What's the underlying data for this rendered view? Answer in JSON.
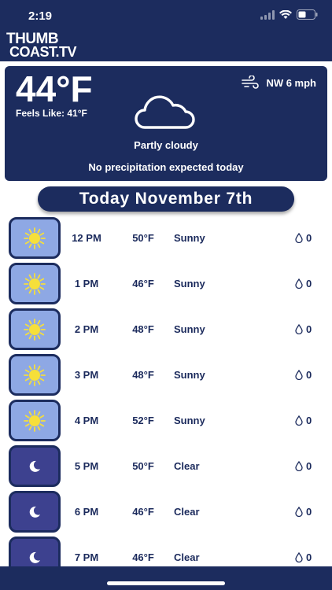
{
  "status": {
    "time": "2:19"
  },
  "logo": {
    "line1": "THUMB",
    "line2": "COAST.TV"
  },
  "current": {
    "temperature": "44°F",
    "feels_like": "Feels Like: 41°F",
    "wind": "NW 6 mph",
    "condition": "Partly cloudy",
    "precipitation": "No precipitation expected today",
    "icon": "cloud-icon"
  },
  "date_heading": "Today November 7th",
  "hourly": [
    {
      "time": "12 PM",
      "temp": "50°F",
      "condition": "Sunny",
      "precip": "0",
      "icon": "sun-icon",
      "period": "day"
    },
    {
      "time": "1 PM",
      "temp": "46°F",
      "condition": "Sunny",
      "precip": "0",
      "icon": "sun-icon",
      "period": "day"
    },
    {
      "time": "2 PM",
      "temp": "48°F",
      "condition": "Sunny",
      "precip": "0",
      "icon": "sun-icon",
      "period": "day"
    },
    {
      "time": "3 PM",
      "temp": "48°F",
      "condition": "Sunny",
      "precip": "0",
      "icon": "sun-icon",
      "period": "day"
    },
    {
      "time": "4 PM",
      "temp": "52°F",
      "condition": "Sunny",
      "precip": "0",
      "icon": "sun-icon",
      "period": "day"
    },
    {
      "time": "5 PM",
      "temp": "50°F",
      "condition": "Clear",
      "precip": "0",
      "icon": "moon-icon",
      "period": "night"
    },
    {
      "time": "6 PM",
      "temp": "46°F",
      "condition": "Clear",
      "precip": "0",
      "icon": "moon-icon",
      "period": "night"
    },
    {
      "time": "7 PM",
      "temp": "46°F",
      "condition": "Clear",
      "precip": "0",
      "icon": "moon-icon",
      "period": "night"
    }
  ],
  "colors": {
    "navy": "#1c2c5e",
    "day_tile": "#8ea8e4",
    "night_tile": "#3d418f",
    "sun": "#f6df3a"
  }
}
